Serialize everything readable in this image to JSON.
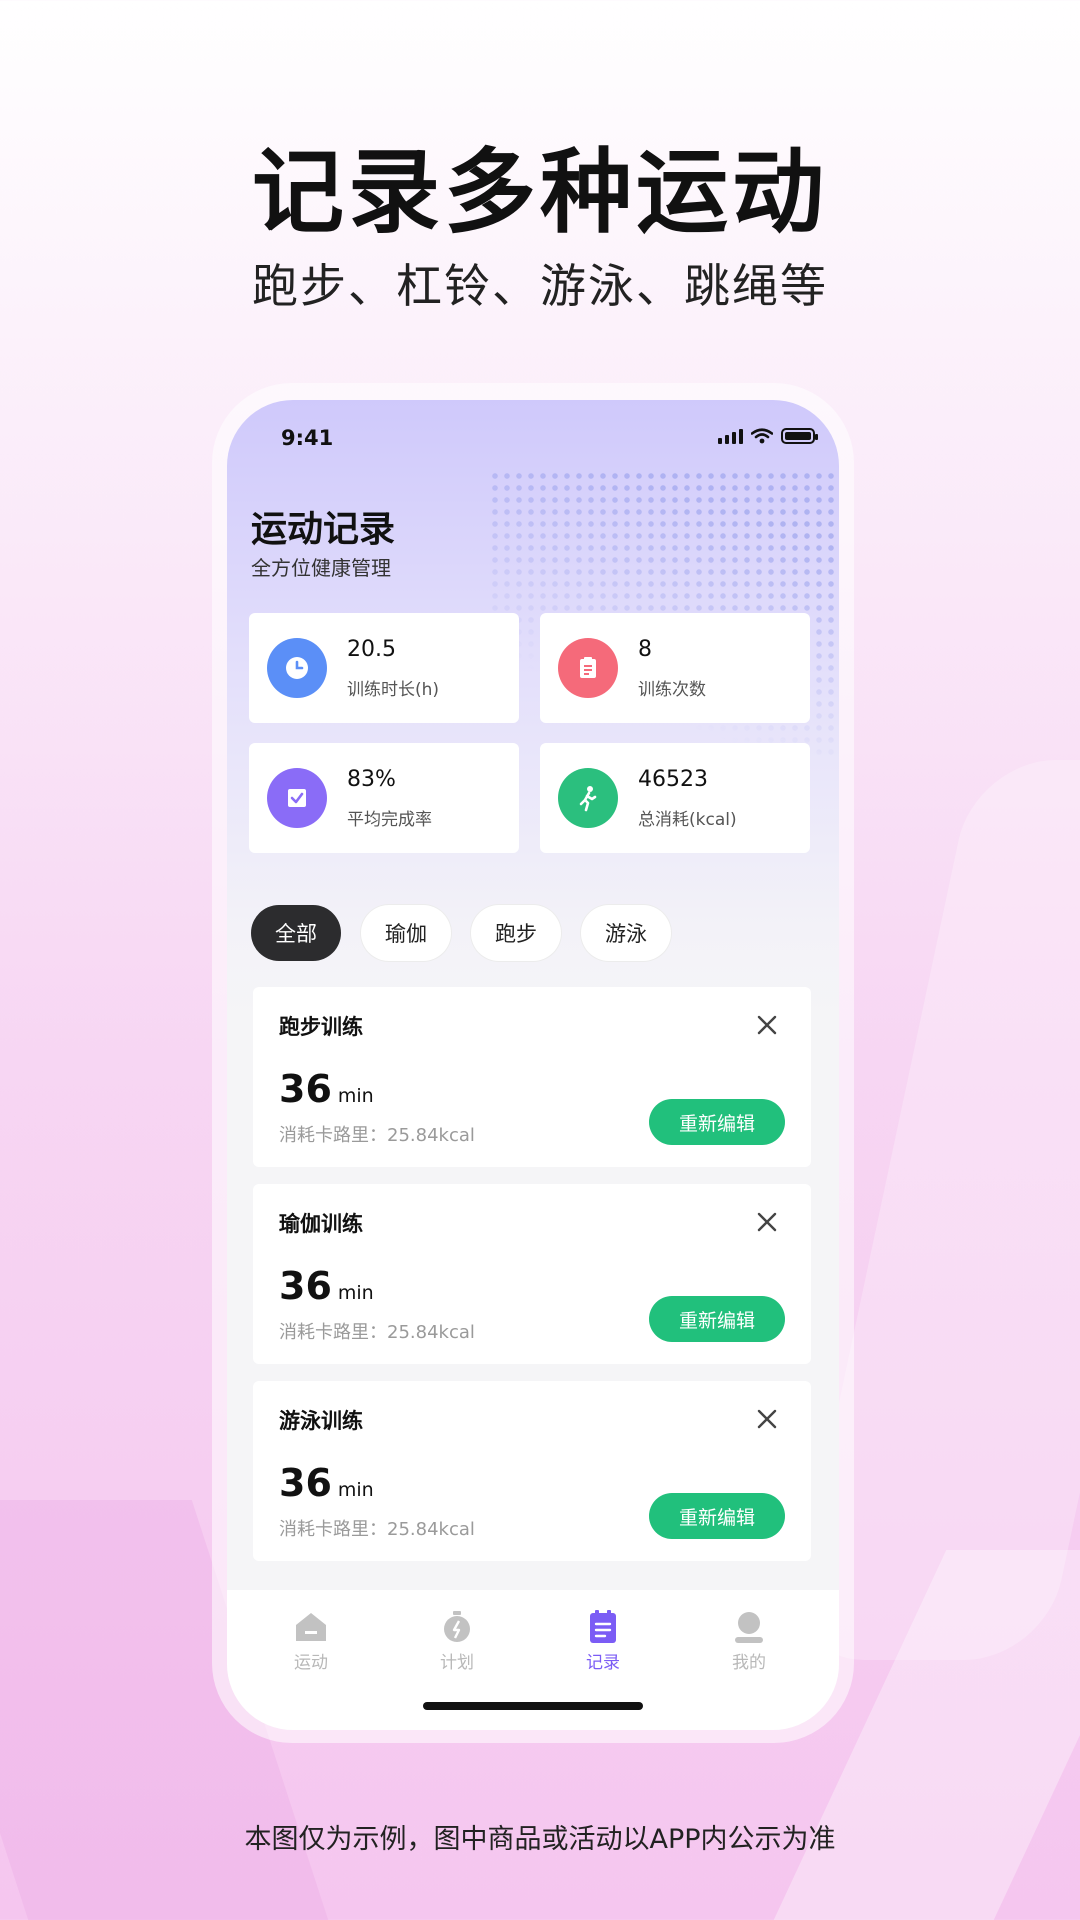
{
  "promo": {
    "headline": "记录多种运动",
    "subline": "跑步、杠铃、游泳、跳绳等",
    "disclaimer": "本图仅为示例，图中商品或活动以APP内公示为准"
  },
  "status_bar": {
    "time": "9:41"
  },
  "header": {
    "title": "运动记录",
    "subtitle": "全方位健康管理"
  },
  "stats": [
    {
      "value": "20.5",
      "label": "训练时长(h)",
      "icon": "clock-icon",
      "color": "#5b8ff7"
    },
    {
      "value": "8",
      "label": "训练次数",
      "icon": "clipboard-icon",
      "color": "#f56a7a"
    },
    {
      "value": "83%",
      "label": "平均完成率",
      "icon": "checklist-icon",
      "color": "#8a6cf7"
    },
    {
      "value": "46523",
      "label": "总消耗(kcal)",
      "icon": "walking-icon",
      "color": "#2bbf7e"
    }
  ],
  "filters": [
    "全部",
    "瑜伽",
    "跑步",
    "游泳"
  ],
  "active_filter": "全部",
  "records": [
    {
      "title": "跑步训练",
      "duration": "36",
      "unit": "min",
      "calories": "消耗卡路里：25.84kcal",
      "button": "重新编辑"
    },
    {
      "title": "瑜伽训练",
      "duration": "36",
      "unit": "min",
      "calories": "消耗卡路里：25.84kcal",
      "button": "重新编辑"
    },
    {
      "title": "游泳训练",
      "duration": "36",
      "unit": "min",
      "calories": "消耗卡路里：25.84kcal",
      "button": "重新编辑"
    }
  ],
  "tabbar": [
    {
      "label": "运动",
      "icon": "home-icon"
    },
    {
      "label": "计划",
      "icon": "stopwatch-icon"
    },
    {
      "label": "记录",
      "icon": "record-icon",
      "active": true
    },
    {
      "label": "我的",
      "icon": "profile-icon"
    }
  ],
  "colors": {
    "accent": "#7b5cf5",
    "button_green": "#21c07c"
  }
}
